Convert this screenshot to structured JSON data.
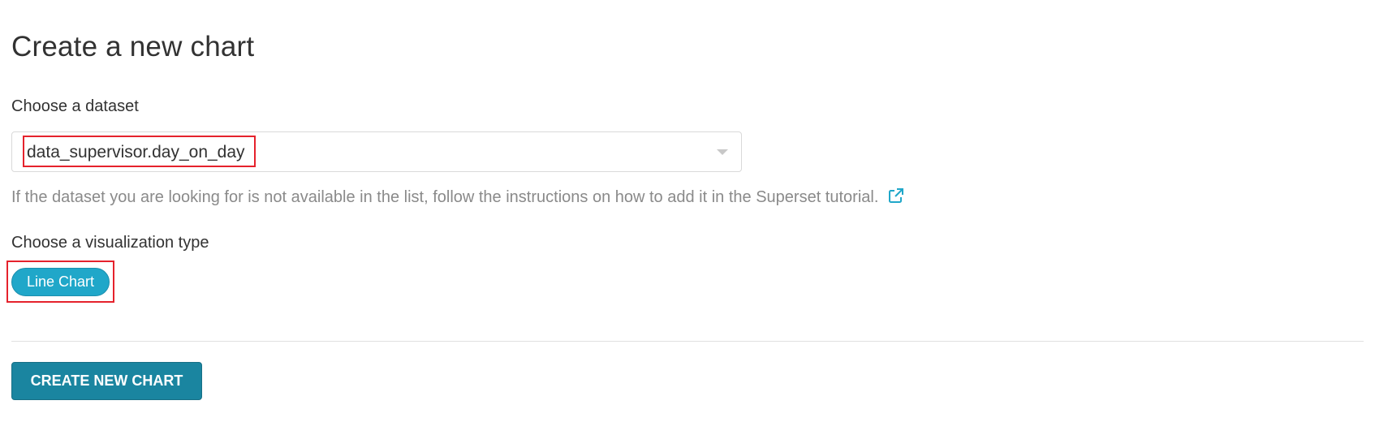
{
  "page": {
    "title": "Create a new chart"
  },
  "dataset": {
    "label": "Choose a dataset",
    "selected_value": "data_supervisor.day_on_day",
    "help_text": "If the dataset you are looking for is not available in the list, follow the instructions on how to add it in the Superset tutorial.",
    "help_link_icon": "external-link-icon"
  },
  "visualization": {
    "label": "Choose a visualization type",
    "selected_type": "Line Chart"
  },
  "actions": {
    "create_label": "CREATE NEW CHART"
  },
  "colors": {
    "accent": "#20a7c9",
    "button": "#1a85a0",
    "highlight": "#e5222c"
  }
}
